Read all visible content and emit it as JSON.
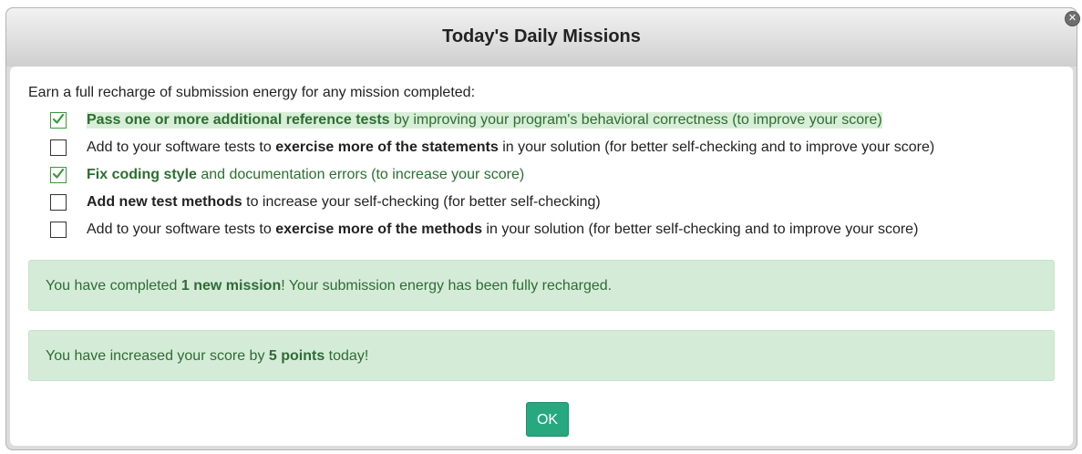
{
  "dialog": {
    "title": "Today's Daily Missions",
    "close_icon": "close-circle-icon",
    "intro": "Earn a full recharge of submission energy for any mission completed:",
    "missions": [
      {
        "checked": true,
        "highlighted": true,
        "bold": "Pass one or more additional reference tests",
        "rest": " by improving your program's behavioral correctness (to improve your score)"
      },
      {
        "checked": false,
        "pre": "Add to your software tests to ",
        "bold": "exercise more of the statements",
        "rest": " in your solution (for better self-checking and to improve your score)"
      },
      {
        "checked": true,
        "bold": "Fix coding style",
        "rest": " and documentation errors (to increase your score)"
      },
      {
        "checked": false,
        "bold": "Add new test methods",
        "rest": " to increase your self-checking (for better self-checking)"
      },
      {
        "checked": false,
        "pre": "Add to your software tests to ",
        "bold": "exercise more of the methods",
        "rest": " in your solution (for better self-checking and to improve your score)"
      }
    ],
    "alert1": {
      "pre": "You have completed ",
      "bold": "1 new mission",
      "post": "! Your submission energy has been fully recharged."
    },
    "alert2": {
      "pre": "You have increased your score by ",
      "bold": "5 points",
      "post": " today!"
    },
    "ok_label": "OK"
  },
  "colors": {
    "success_text": "#2f6b35",
    "success_bg": "#d4ecd7",
    "ok_button": "#28a87f",
    "check_mark": "#3a9a3a"
  }
}
